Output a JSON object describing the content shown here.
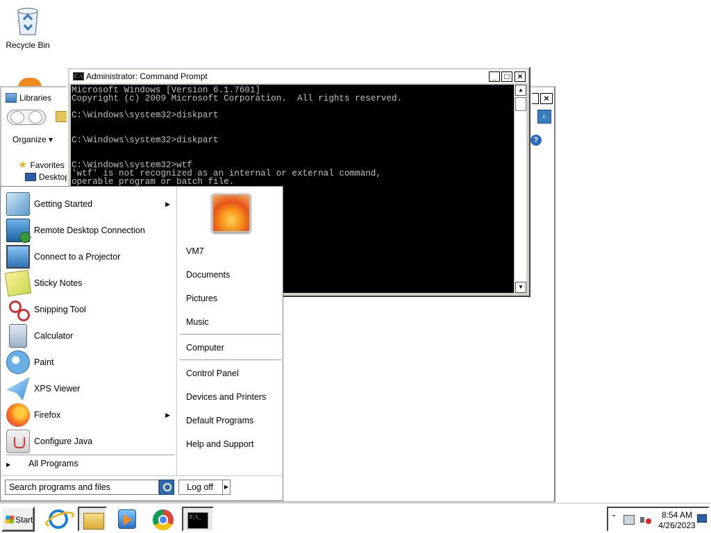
{
  "desktop": {
    "recycle_bin_label": "Recycle Bin"
  },
  "explorer": {
    "title": "Libraries",
    "organize_label": "Organize",
    "favorites_label": "Favorites",
    "desktop_item_label": "Desktop"
  },
  "cmd": {
    "title": "Administrator: Command Prompt",
    "lines": [
      "Microsoft Windows [Version 6.1.7601]",
      "Copyright (c) 2009 Microsoft Corporation.  All rights reserved.",
      "",
      "C:\\Windows\\system32>diskpart",
      "",
      "",
      "C:\\Windows\\system32>diskpart",
      "",
      "",
      "C:\\Windows\\system32>wtf",
      "'wtf' is not recognized as an internal or external command,",
      "operable program or batch file."
    ]
  },
  "start_menu": {
    "programs": [
      {
        "label": "Getting Started",
        "icon": "getting-started-icon",
        "has_submenu": true
      },
      {
        "label": "Remote Desktop Connection",
        "icon": "remote-desktop-icon",
        "has_submenu": false
      },
      {
        "label": "Connect to a Projector",
        "icon": "projector-icon",
        "has_submenu": false
      },
      {
        "label": "Sticky Notes",
        "icon": "sticky-notes-icon",
        "has_submenu": false
      },
      {
        "label": "Snipping Tool",
        "icon": "snipping-tool-icon",
        "has_submenu": false
      },
      {
        "label": "Calculator",
        "icon": "calculator-icon",
        "has_submenu": false
      },
      {
        "label": "Paint",
        "icon": "paint-icon",
        "has_submenu": false
      },
      {
        "label": "XPS Viewer",
        "icon": "xps-viewer-icon",
        "has_submenu": false
      },
      {
        "label": "Firefox",
        "icon": "firefox-icon",
        "has_submenu": true
      },
      {
        "label": "Configure Java",
        "icon": "java-icon",
        "has_submenu": false
      }
    ],
    "all_programs_label": "All Programs",
    "search_placeholder": "Search programs and files",
    "right_items": {
      "user": "VM7",
      "documents": "Documents",
      "pictures": "Pictures",
      "music": "Music",
      "computer": "Computer",
      "control_panel": "Control Panel",
      "devices_printers": "Devices and Printers",
      "default_programs": "Default Programs",
      "help_support": "Help and Support"
    },
    "log_off_label": "Log off"
  },
  "taskbar": {
    "start_label": "Start",
    "pinned": [
      "internet-explorer-icon",
      "windows-explorer-icon",
      "media-player-icon",
      "chrome-icon",
      "command-prompt-icon"
    ],
    "time": "8:54 AM",
    "date": "4/26/2023"
  }
}
